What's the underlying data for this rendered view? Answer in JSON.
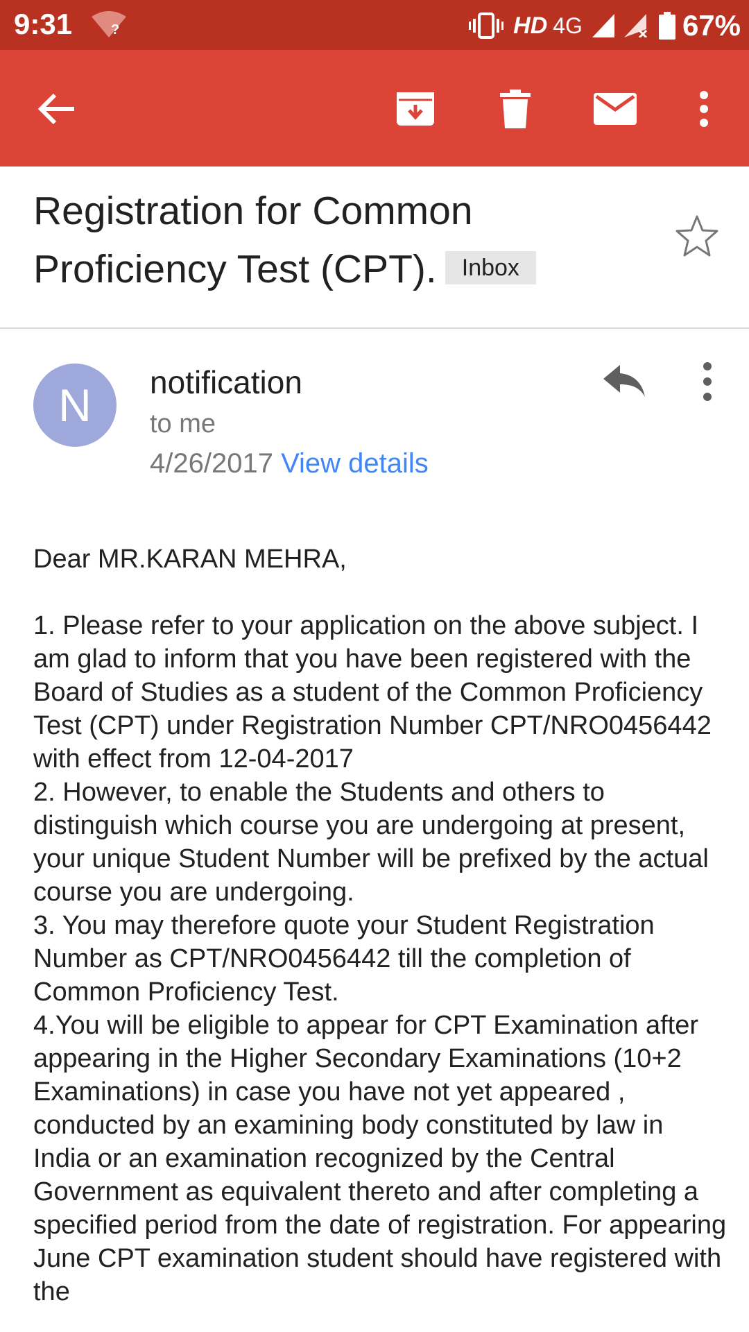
{
  "status_bar": {
    "time": "9:31",
    "hd": "HD",
    "network": "4G",
    "battery": "67%",
    "bg_color": "#b93221"
  },
  "app_bar": {
    "bg_color": "#db4437",
    "icons": [
      "back-arrow-icon",
      "archive-icon",
      "delete-icon",
      "mark-unread-icon",
      "more-vert-icon"
    ]
  },
  "email": {
    "subject": "Registration for Common Proficiency Test (CPT).",
    "label": "Inbox",
    "sender": {
      "initial": "N",
      "name": "notification",
      "recipient": "to me",
      "date": "4/26/2017",
      "view_details": "View details",
      "avatar_color": "#9fa8da"
    },
    "body": {
      "greeting": "Dear MR.KARAN MEHRA,",
      "p1": "1. Please refer to your application on the above subject. I am glad to inform that you have been registered with the Board of Studies as a student of the Common Proficiency Test (CPT) under Registration Number CPT/NRO0456442 with effect from 12-04-2017",
      "p2": "2. However, to enable the Students and others to distinguish which course you are undergoing at present, your unique Student Number will be prefixed by the actual course you are undergoing.",
      "p3": "3. You may therefore quote your Student Registration Number as CPT/NRO0456442 till the completion of Common Proficiency Test.",
      "p4": "4.You will be eligible to appear for CPT Examination after appearing in the Higher Secondary Examinations (10+2 Examinations) in case you have not yet appeared , conducted by an examining body constituted by law in India or an examination recognized by the Central Government as equivalent thereto and after completing a specified period from the date of registration. For appearing June CPT examination student should have registered with the"
    }
  }
}
